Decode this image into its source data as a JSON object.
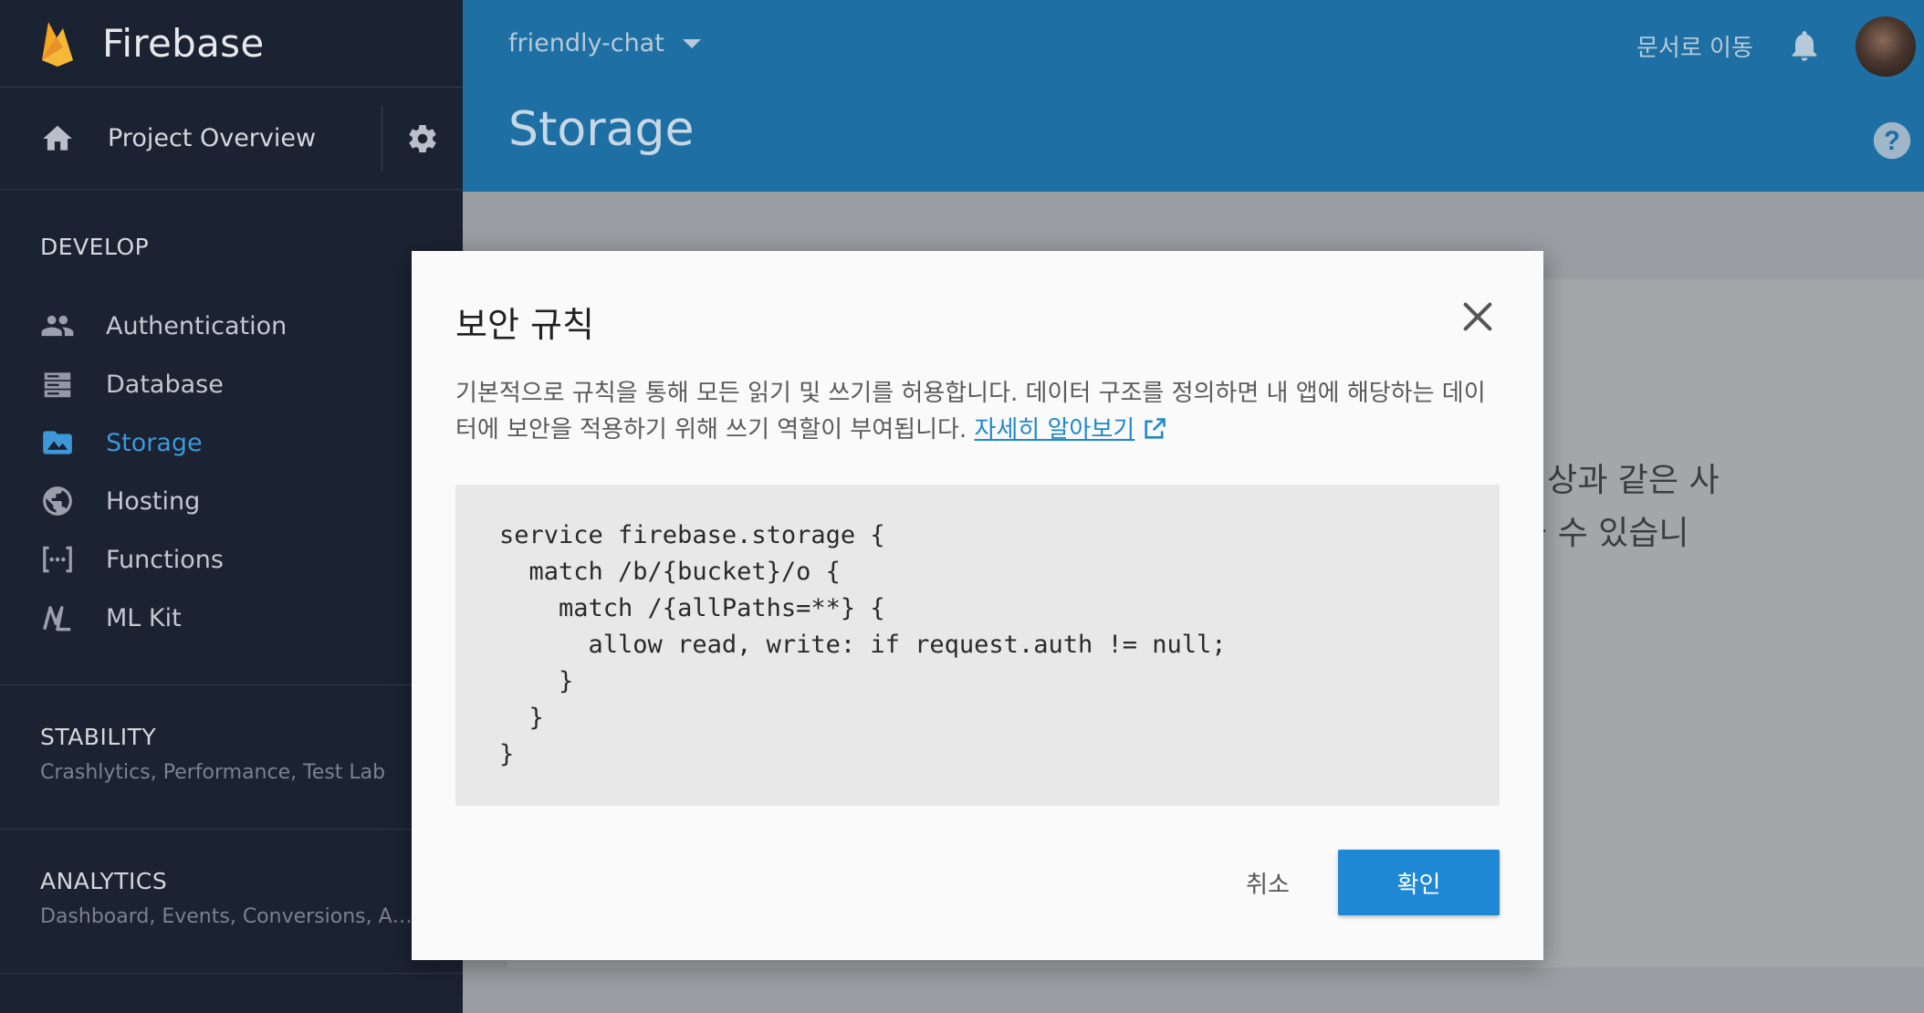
{
  "brand": {
    "name": "Firebase"
  },
  "sidebar": {
    "overview_label": "Project Overview",
    "develop_title": "DEVELOP",
    "items": [
      {
        "label": "Authentication",
        "icon": "people-icon"
      },
      {
        "label": "Database",
        "icon": "database-icon"
      },
      {
        "label": "Storage",
        "icon": "image-icon",
        "active": true
      },
      {
        "label": "Hosting",
        "icon": "globe-icon"
      },
      {
        "label": "Functions",
        "icon": "functions-icon"
      },
      {
        "label": "ML Kit",
        "icon": "mlkit-icon"
      }
    ],
    "stability": {
      "title": "STABILITY",
      "subtitle": "Crashlytics, Performance, Test Lab"
    },
    "analytics": {
      "title": "ANALYTICS",
      "subtitle": "Dashboard, Events, Conversions, Au..."
    }
  },
  "header": {
    "project": "friendly-chat",
    "docs_link": "문서로 이동",
    "page_title": "Storage"
  },
  "background": {
    "line1": "영상과 같은 사",
    "line2": "을 수 있습니"
  },
  "dialog": {
    "title": "보안 규칙",
    "description_line1": "기본적으로 규칙을 통해 모든 읽기 및 쓰기를 허용합니다. 데이터 구조를 정의하면 내 앱에 해당하는 데이",
    "description_line2": "터에 보안을 적용하기 위해 쓰기 역할이 부여됩니다.",
    "learn_more": "자세히 알아보기",
    "code": [
      "service firebase.storage {",
      "  match /b/{bucket}/o {",
      "    match /{allPaths=**} {",
      "      allow read, write: if request.auth != null;",
      "    }",
      "  }",
      "}"
    ],
    "cancel_label": "취소",
    "ok_label": "확인"
  },
  "colors": {
    "sidebar_bg": "#1b2231",
    "header_bg": "#1e6fa3",
    "accent": "#1e88d5",
    "active_nav": "#3d97d8",
    "firebase_orange": "#f5a623"
  }
}
